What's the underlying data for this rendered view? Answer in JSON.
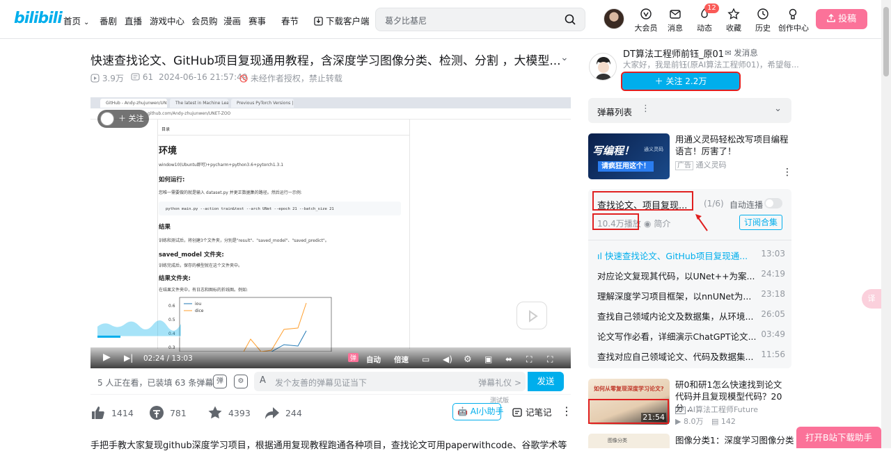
{
  "header": {
    "logo": "bilibili",
    "nav": [
      "首页",
      "番剧",
      "直播",
      "游戏中心",
      "会员购",
      "漫画",
      "赛事",
      "春节",
      "下载客户端"
    ],
    "search_placeholder": "葛夕比基尼",
    "icons": [
      {
        "label": "大会员",
        "icon": "vip-icon"
      },
      {
        "label": "消息",
        "icon": "message-icon"
      },
      {
        "label": "动态",
        "icon": "dynamic-icon"
      },
      {
        "label": "收藏",
        "icon": "star-icon"
      },
      {
        "label": "历史",
        "icon": "history-icon"
      },
      {
        "label": "创作中心",
        "icon": "creator-icon"
      }
    ],
    "dynamic_badge": "12",
    "upload_label": "投稿"
  },
  "video": {
    "title": "快速查找论文、GitHub项目复现通用教程，含深度学习图像分类、检测、分割 ，大模型...",
    "views": "3.9万",
    "danmaku_count": "61",
    "date": "2024-06-16 21:57:49",
    "copyright": "未经作者授权，禁止转载"
  },
  "player": {
    "follow_bubble": "关注",
    "browser_tabs": [
      "GitHub - Andy-zhujunwen/UNET-ZOO",
      "The latest in Machine Learning",
      "Previous PyTorch Versions | PyTorch"
    ],
    "url": "github.com/Andy-zhujunwen/UNET-ZOO",
    "doc_tab": "目录",
    "doc_heading1": "环境",
    "doc_env": "window10(Ubuntu即可)+pycharm+python3.6+pytorch1.3.1",
    "doc_heading2": "如何运行:",
    "doc_run_text": "您唯一需要做的就是输入 dataset.py 并更正数据集的路径。然后运行一示例:",
    "doc_code": "python main.py --action train&test --arch UNet --epoch 21 --batch_size 21",
    "doc_heading3": "结果",
    "doc_result_text": "训练和测试后，将创建3个文件夹，分别是\"result\"、\"saved_model\"、\"saved_predict\"。",
    "doc_heading4": "saved_model 文件夹:",
    "doc_saved_text": "训练完成后，保存的模型就在这个文件夹中。",
    "doc_heading5": "结果文件夹:",
    "doc_result_folder_text": "在结果文件夹中，有日志和图标的折线图。例如:",
    "legend": [
      "iou",
      "dice"
    ],
    "yticks": [
      "0.6",
      "0.5",
      "0.4",
      "0.3"
    ],
    "time_current": "02:24",
    "time_total": "13:03",
    "progress": 0.184,
    "controls": [
      "自动",
      "倍速"
    ]
  },
  "danmaku_bar": {
    "watching": "5 人正在看，已装填 63 条弹幕",
    "input_placeholder": "发个友善的弹幕见证当下",
    "etiquette": "弹幕礼仪 >",
    "send": "发送"
  },
  "actions": {
    "like": "1414",
    "coin": "781",
    "favorite": "4393",
    "share": "244",
    "ai_label": "AI小助手",
    "ai_tag": "测试版",
    "notes": "记笔记"
  },
  "description": "手把手教大家复现github深度学习项目，根据通用复现教程跑通各种项目，查找论文可用paperwithcode、谷歌学术等",
  "uploader": {
    "name": "DT算法工程师前钰_原01",
    "message": "发消息",
    "bio": "大家好，我是前钰(原AI算法工程师01)，希望每...",
    "follow": "关注 2.2万"
  },
  "danmaku_list": {
    "label": "弹幕列表"
  },
  "ad": {
    "thumb_text1": "写编程！",
    "thumb_text2": "通义灵码",
    "thumb_text3": "请疯狂用这个！",
    "title": "用通义灵码轻松改写项目编程语言！厉害了！",
    "tag": "广告",
    "source": "通义灵码"
  },
  "playlist": {
    "title": "查找论文、项目复现...",
    "position": "(1/6)",
    "autoplay": "自动连播",
    "plays": "10.4万播放",
    "intro": "简介",
    "subscribe": "订阅合集",
    "items": [
      {
        "title": "快速查找论文、GitHub项目复现通...",
        "duration": "13:03",
        "active": true
      },
      {
        "title": "对应论文复现其代码，以UNet++为案...",
        "duration": "24:19",
        "active": false
      },
      {
        "title": "理解深度学习项目框架，以nnUNet为...",
        "duration": "23:18",
        "active": false
      },
      {
        "title": "查找自己领域内论文及数据集，从环境...",
        "duration": "26:05",
        "active": false
      },
      {
        "title": "论文写作必看，详细演示ChatGPT论文...",
        "duration": "03:49",
        "active": false
      },
      {
        "title": "查找对应自己领域论文、代码及数据集...",
        "duration": "11:56",
        "active": false
      }
    ]
  },
  "recommend": [
    {
      "title": "研0和研1怎么快速找到论文代码并且复现模型代码？20分...",
      "uploader": "AI算法工程师Future",
      "views": "8.0万",
      "danmaku": "142",
      "duration": "21:54",
      "thumb_text": "如何从零复现深度学习论文?"
    },
    {
      "title": "图像分类1：深度学习图像分类",
      "thumb_text": "图像分类"
    }
  ],
  "download_helper": "打开B站下载助手",
  "colors": {
    "brand_blue": "#00aeec",
    "brand_pink": "#fb7299",
    "annotation_red": "#e02020"
  }
}
